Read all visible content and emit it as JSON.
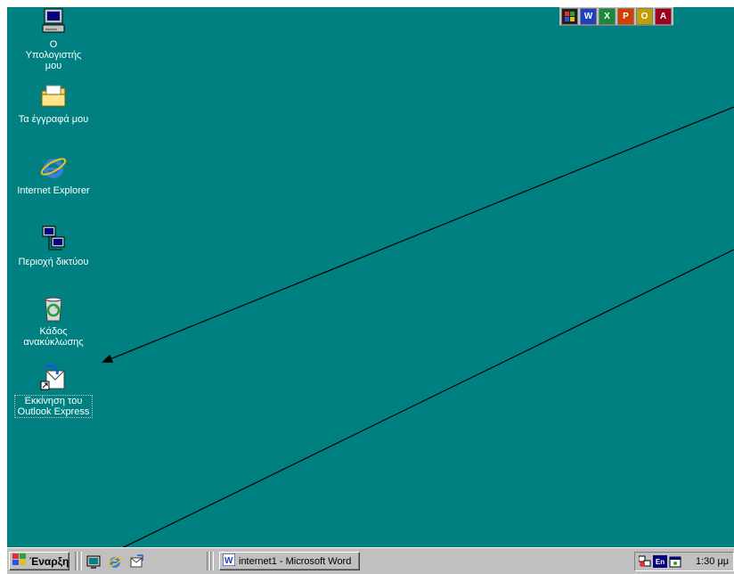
{
  "desktop": {
    "background_color": "#008080",
    "icons": [
      {
        "label": "Ο Υπολογιστής μου",
        "icon": "my-computer-icon"
      },
      {
        "label": "Τα έγγραφά μου",
        "icon": "my-documents-folder-icon"
      },
      {
        "label": "Internet Explorer",
        "icon": "internet-explorer-icon"
      },
      {
        "label": "Περιοχή δικτύου",
        "icon": "network-neighborhood-icon"
      },
      {
        "label": "Κάδος ανακύκλωσης",
        "icon": "recycle-bin-icon"
      },
      {
        "label": "Εκκίνηση του Outlook Express",
        "icon": "outlook-express-icon"
      }
    ]
  },
  "office_bar": {
    "buttons": [
      {
        "icon": "office-logo-icon",
        "color": "#000080"
      },
      {
        "icon": "word-icon",
        "color": "#1f3fbf",
        "text": "W"
      },
      {
        "icon": "excel-icon",
        "color": "#1a8a3a",
        "text": "X"
      },
      {
        "icon": "powerpoint-icon",
        "color": "#d04000",
        "text": "P"
      },
      {
        "icon": "outlook-icon",
        "color": "#c0a000",
        "text": "O"
      },
      {
        "icon": "access-icon",
        "color": "#a00020",
        "text": "A"
      }
    ]
  },
  "taskbar": {
    "start_label": "Έναρξη",
    "quick_launch": [
      {
        "icon": "show-desktop-icon"
      },
      {
        "icon": "internet-explorer-icon"
      },
      {
        "icon": "outlook-express-icon"
      }
    ],
    "tasks": [
      {
        "label": "internet1 - Microsoft Word",
        "icon": "word-doc-icon"
      }
    ],
    "tray": {
      "icons": [
        "network-tray-icon",
        "language-indicator-icon",
        "task-scheduler-icon"
      ],
      "language": "En",
      "clock": "1:30 μμ"
    }
  },
  "colors": {
    "accent": "#000080",
    "face": "#c0c0c0"
  }
}
